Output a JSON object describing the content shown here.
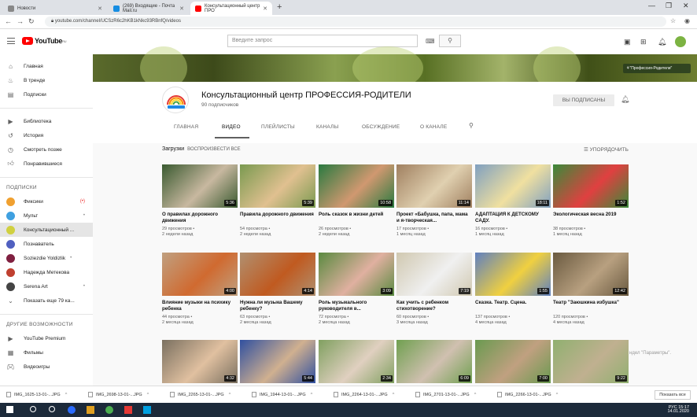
{
  "browser": {
    "tabs": [
      {
        "title": "Новости",
        "favcolor": "#888888"
      },
      {
        "title": "(269) Входящие - Почта Mail.ru",
        "favcolor": "#168de2"
      },
      {
        "title": "Консультационный центр ПРО",
        "favcolor": "#ff0000"
      }
    ],
    "url": "youtube.com/channel/UCSzR6c2hKB1kNkc93RBnfQ/videos"
  },
  "yt": {
    "logo_text": "YouTube",
    "logo_region": "RU",
    "search_placeholder": "Введите запрос"
  },
  "sidebar": {
    "main": [
      {
        "label": "Главная",
        "icon": "home-icon"
      },
      {
        "label": "В тренде",
        "icon": "fire-icon"
      },
      {
        "label": "Подписки",
        "icon": "subscriptions-icon"
      }
    ],
    "library": [
      {
        "label": "Библиотека",
        "icon": "library-icon"
      },
      {
        "label": "История",
        "icon": "history-icon"
      },
      {
        "label": "Смотреть позже",
        "icon": "clock-icon"
      },
      {
        "label": "Понравившиеся",
        "icon": "thumb-up-icon"
      }
    ],
    "subs_heading": "ПОДПИСКИ",
    "subs": [
      {
        "label": "Фиксики",
        "color": "#f0a030",
        "badge": "(•)"
      },
      {
        "label": "Мульт",
        "color": "#3fa0e0",
        "badge": "•"
      },
      {
        "label": "Консультационный ...",
        "color": "#d0d040",
        "badge": ""
      },
      {
        "label": "Познаватель",
        "color": "#5060c0",
        "badge": ""
      },
      {
        "label": "Soziezdie Yoldizlik",
        "color": "#802040",
        "badge": "•"
      },
      {
        "label": "Надежда Метекова",
        "color": "#c04030",
        "badge": ""
      },
      {
        "label": "Serena Art",
        "color": "#444444",
        "badge": "•"
      }
    ],
    "more_label": "Показать еще 79 ка...",
    "other_heading": "ДРУГИЕ ВОЗМОЖНОСТИ",
    "other": [
      {
        "label": "YouTube Premium",
        "icon": "youtube-icon"
      },
      {
        "label": "Фильмы",
        "icon": "film-icon"
      },
      {
        "label": "Видеоигры",
        "icon": "gamepad-icon"
      }
    ]
  },
  "banner": {
    "button": "\"Профессия-Родители\""
  },
  "channel": {
    "name": "Консультационный центр ПРОФЕССИЯ-РОДИТЕЛИ",
    "subscribers": "90 подписчиков",
    "subscribed_label": "ВЫ ПОДПИСАНЫ",
    "tabs": [
      "ГЛАВНАЯ",
      "ВИДЕО",
      "ПЛЕЙЛИСТЫ",
      "КАНАЛЫ",
      "ОБСУЖДЕНИЕ",
      "О КАНАЛЕ"
    ]
  },
  "uploads": {
    "title": "Загрузки",
    "play_all": "ВОСПРОИЗВЕСТИ ВСЕ",
    "sort": "УПОРЯДОЧИТЬ"
  },
  "videos": [
    {
      "title": "О правилах дорожного движения",
      "views": "29 просмотров •",
      "age": "2 недели назад",
      "dur": "5:36",
      "c1": "#3a5a30",
      "c2": "#c8b8a0"
    },
    {
      "title": "Правила дорожного движения",
      "views": "54 просмотра •",
      "age": "2 недели назад",
      "dur": "5:39",
      "c1": "#7a9a50",
      "c2": "#e0c090"
    },
    {
      "title": "Роль сказок в жизни детей",
      "views": "26 просмотров •",
      "age": "2 недели назад",
      "dur": "10:58",
      "c1": "#2a7a40",
      "c2": "#d09870"
    },
    {
      "title": "Проект «Бабушка, папа, мама и я-творческая...",
      "views": "17 просмотров •",
      "age": "1 месяц назад",
      "dur": "11:14",
      "c1": "#a08060",
      "c2": "#e0d0b0"
    },
    {
      "title": "АДАПТАЦИЯ К ДЕТСКОМУ САДУ.",
      "views": "16 просмотров •",
      "age": "1 месяц назад",
      "dur": "18:11",
      "c1": "#80a0c0",
      "c2": "#f0e0a0"
    },
    {
      "title": "Экологическая весна 2019",
      "views": "38 просмотров •",
      "age": "1 месяц назад",
      "dur": "1:52",
      "c1": "#3a8a3a",
      "c2": "#e04040"
    },
    {
      "title": "Влияние музыки на психику ребенка",
      "views": "44 просмотра •",
      "age": "2 месяца назад",
      "dur": "4:00",
      "c1": "#c0a080",
      "c2": "#d06a30"
    },
    {
      "title": "Нужна ли музыка Вашему ребенку?",
      "views": "63 просмотра •",
      "age": "2 месяца назад",
      "dur": "4:14",
      "c1": "#b09070",
      "c2": "#c05a20"
    },
    {
      "title": "Роль музыкального руководителя в...",
      "views": "72 просмотра •",
      "age": "2 месяца назад",
      "dur": "3:09",
      "c1": "#5a8a40",
      "c2": "#e0b0a0"
    },
    {
      "title": "Как учить с ребенком стихотворение?",
      "views": "60 просмотров •",
      "age": "3 месяца назад",
      "dur": "7:19",
      "c1": "#d0c8b0",
      "c2": "#f0f0f0"
    },
    {
      "title": "Сказка. Театр. Сцена.",
      "views": "137 просмотров •",
      "age": "4 месяца назад",
      "dur": "1:55",
      "c1": "#6080c0",
      "c2": "#f0d040"
    },
    {
      "title": "Театр \"Заюшкина избушка\"",
      "views": "120 просмотров •",
      "age": "4 месяца назад",
      "dur": "12:42",
      "c1": "#6a5a40",
      "c2": "#b8a080"
    },
    {
      "title": "",
      "views": "",
      "age": "",
      "dur": "4:32",
      "c1": "#7a7060",
      "c2": "#e0c0a0"
    },
    {
      "title": "",
      "views": "",
      "age": "",
      "dur": "5:44",
      "c1": "#3050a0",
      "c2": "#d0b090"
    },
    {
      "title": "",
      "views": "",
      "age": "",
      "dur": "2:34",
      "c1": "#80a060",
      "c2": "#e0d0c0"
    },
    {
      "title": "",
      "views": "",
      "age": "",
      "dur": "6:09",
      "c1": "#70a050",
      "c2": "#d0c0b0"
    },
    {
      "title": "",
      "views": "",
      "age": "",
      "dur": "7:00",
      "c1": "#6a9a50",
      "c2": "#c0a080"
    },
    {
      "title": "",
      "views": "",
      "age": "",
      "dur": "9:22",
      "c1": "#90b070",
      "c2": "#c0b090"
    }
  ],
  "watermark": "ндел \"Параметры\".",
  "downloads": [
    "IMG_1625-13-01-...JPG",
    "IMG_2698-13-01-...JPG",
    "IMG_2265-13-01-...JPG",
    "IMG_1944-13-01-...JPG",
    "IMG_2264-13-01-...JPG",
    "IMG_2701-13-01-...JPG",
    "IMG_2266-13-01-...JPG"
  ],
  "show_all": "Показать все",
  "tray": {
    "lang": "РУС",
    "time": "15:17",
    "date": "14.01.2020"
  }
}
